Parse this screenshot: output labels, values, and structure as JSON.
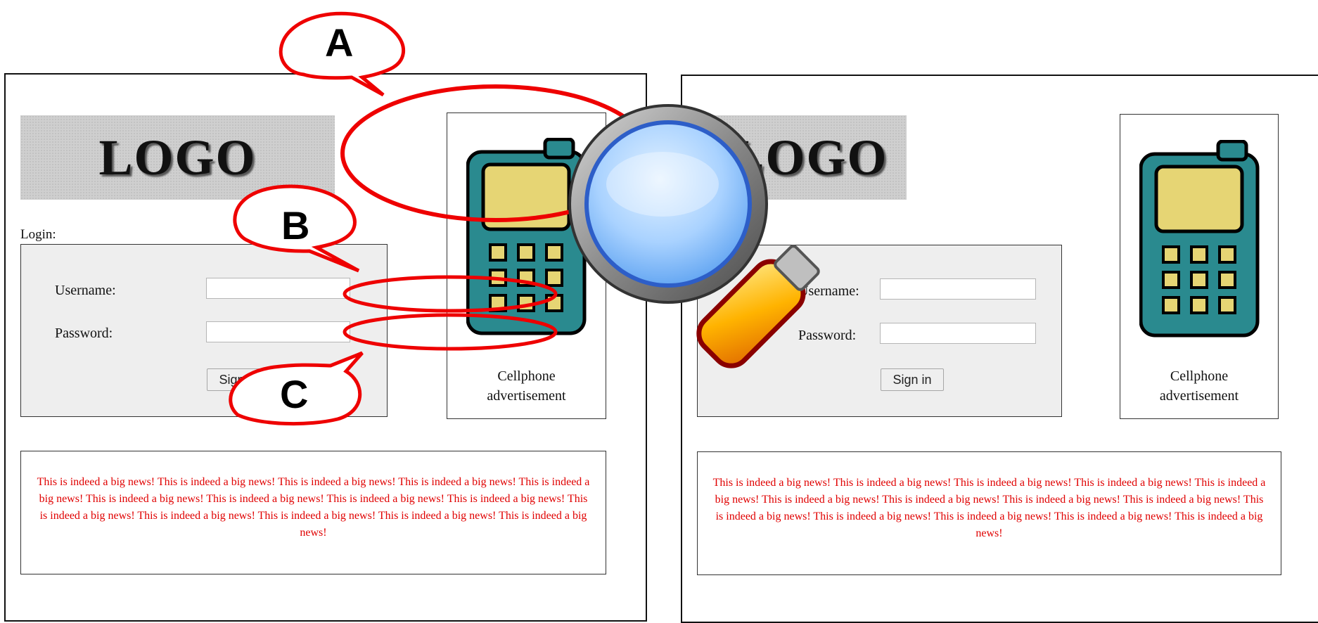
{
  "left_page": {
    "logo_text": "LOGO",
    "login_caption": "Login:",
    "username_label": "Username:",
    "username_value": "",
    "password_label": "Password:",
    "password_value": "",
    "signin_label": "Sign in",
    "ad_caption": "Cellphone\nadvertisement",
    "news_text": "This is indeed a big news! This is indeed a big news! This is indeed a big news! This is indeed a big news! This is indeed a big news! This is indeed a big news! This is indeed a big news! This is indeed a big news! This is indeed a big news! This is indeed a big news! This is indeed a big news! This is indeed a big news! This is indeed a big news! This is indeed a big news!"
  },
  "right_page": {
    "logo_text": "LOGO",
    "username_label": "Username:",
    "username_value": "",
    "password_label": "Password:",
    "password_value": "",
    "signin_label": "Sign in",
    "ad_caption": "Cellphone\nadvertisement",
    "news_text": "This is indeed a big news! This is indeed a big news! This is indeed a big news! This is indeed a big news! This is indeed a big news! This is indeed a big news! This is indeed a big news! This is indeed a big news! This is indeed a big news! This is indeed a big news! This is indeed a big news! This is indeed a big news! This is indeed a big news! This is indeed a big news!"
  },
  "callouts": {
    "a": "A",
    "b": "B",
    "c": "C"
  },
  "icons": {
    "phone": "cellphone-icon",
    "magnifier": "magnifying-glass-icon"
  },
  "colors": {
    "callout_red": "#ee0000",
    "news_red": "#e00000",
    "panel_gray": "#eeeeee",
    "phone_teal": "#2a8a8f",
    "phone_screen": "#e6d574"
  }
}
